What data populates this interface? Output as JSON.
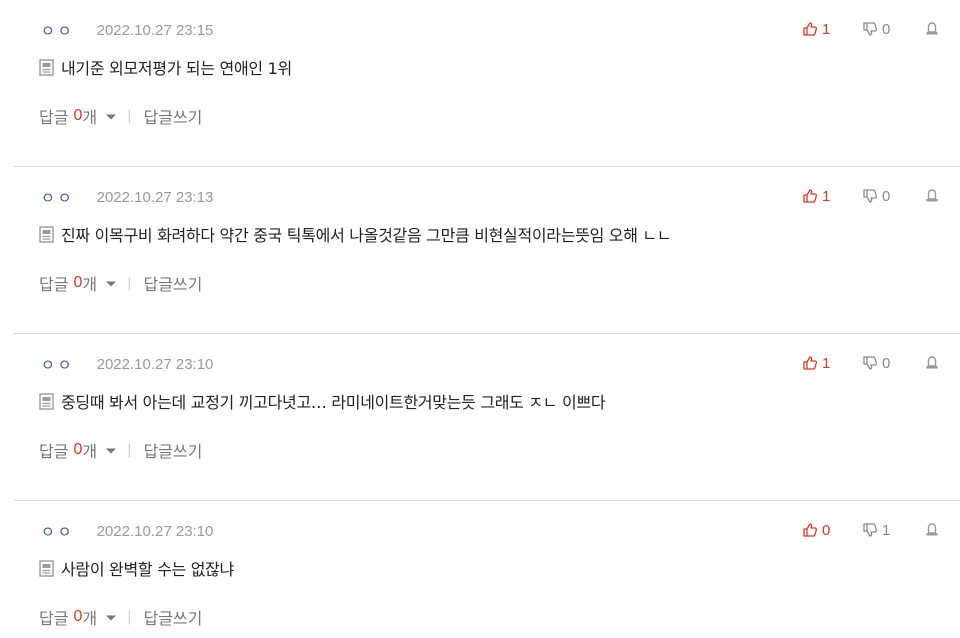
{
  "comments": [
    {
      "nickname": "ㅇㅇ",
      "date": "2022.10.27 23:15",
      "text": "내기준 외모저평가 되는 연애인 1위",
      "up": "1",
      "down": "0",
      "reply_label": "답글",
      "reply_count": "0",
      "reply_unit": "개",
      "write_reply": "답글쓰기"
    },
    {
      "nickname": "ㅇㅇ",
      "date": "2022.10.27 23:13",
      "text": "진짜 이목구비 화려하다 약간 중국 틱톡에서 나올것같음 그만큼 비현실적이라는뜻임 오해 ㄴㄴ",
      "up": "1",
      "down": "0",
      "reply_label": "답글",
      "reply_count": "0",
      "reply_unit": "개",
      "write_reply": "답글쓰기"
    },
    {
      "nickname": "ㅇㅇ",
      "date": "2022.10.27 23:10",
      "text": "중딩때 봐서 아는데 교정기 끼고다녓고… 라미네이트한거맞는듯 그래도 ㅈㄴ 이쁘다",
      "up": "1",
      "down": "0",
      "reply_label": "답글",
      "reply_count": "0",
      "reply_unit": "개",
      "write_reply": "답글쓰기"
    },
    {
      "nickname": "ㅇㅇ",
      "date": "2022.10.27 23:10",
      "text": "사람이 완벽할 수는 없잖냐",
      "up": "0",
      "down": "1",
      "reply_label": "답글",
      "reply_count": "0",
      "reply_unit": "개",
      "write_reply": "답글쓰기"
    }
  ],
  "icons": {
    "up": "thumbs-up-icon",
    "down": "thumbs-down-icon",
    "report": "report-icon",
    "doc": "document-icon",
    "caret": "caret-down-icon"
  },
  "colors": {
    "nickname": "#3e5f9c",
    "accent": "#d93a26",
    "muted": "#9a9a9a"
  }
}
